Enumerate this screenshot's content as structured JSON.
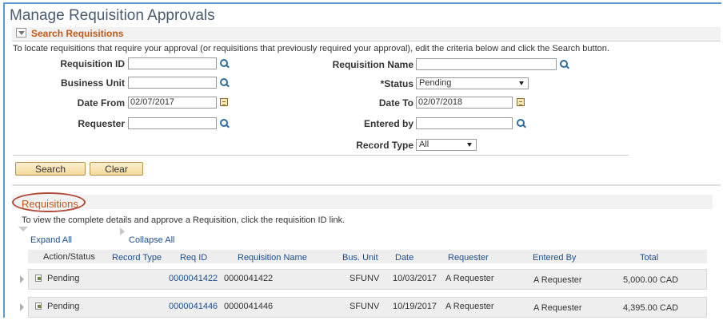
{
  "page_title": "Manage Requisition Approvals",
  "search": {
    "section_title": "Search Requisitions",
    "intro": "To locate requisitions that require your approval (or requisitions that previously required your approval), edit the criteria below and click the Search button.",
    "labels": {
      "requisition_id": "Requisition ID",
      "business_unit": "Business Unit",
      "date_from": "Date From",
      "requester": "Requester",
      "requisition_name": "Requisition Name",
      "status": "*Status",
      "date_to": "Date To",
      "entered_by": "Entered by",
      "record_type": "Record Type"
    },
    "values": {
      "requisition_id": "",
      "business_unit": "",
      "date_from": "02/07/2017",
      "requester": "",
      "requisition_name": "",
      "status": "Pending",
      "date_to": "02/07/2018",
      "entered_by": "",
      "record_type": "All"
    },
    "search_button": "Search",
    "clear_button": "Clear"
  },
  "requisitions": {
    "section_title": "Requisitions",
    "intro": "To view the complete details and approve a Requisition, click the requisition ID link.",
    "expand_all": "Expand All",
    "collapse_all": "Collapse All",
    "columns": [
      "Action/Status",
      "Record Type",
      "Req ID",
      "Requisition Name",
      "Bus. Unit",
      "Date",
      "Requester",
      "Entered By",
      "Total"
    ],
    "rows": [
      {
        "status": "Pending",
        "record_type": "",
        "req_id": "0000041422",
        "name": "0000041422",
        "bus_unit": "SFUNV",
        "date": "10/03/2017",
        "requester": "A Requester",
        "entered_by": "A Requester",
        "total": "5,000.00 CAD"
      },
      {
        "status": "Pending",
        "record_type": "",
        "req_id": "0000041446",
        "name": "0000041446",
        "bus_unit": "SFUNV",
        "date": "10/19/2017",
        "requester": "A Requester",
        "entered_by": "A Requester",
        "total": "4,395.00 CAD"
      }
    ]
  },
  "colors": {
    "accent": "#c3581a",
    "link": "#1f4e8c",
    "highlight_oval": "#b04a3a",
    "frame_border": "#5b9bd5"
  }
}
